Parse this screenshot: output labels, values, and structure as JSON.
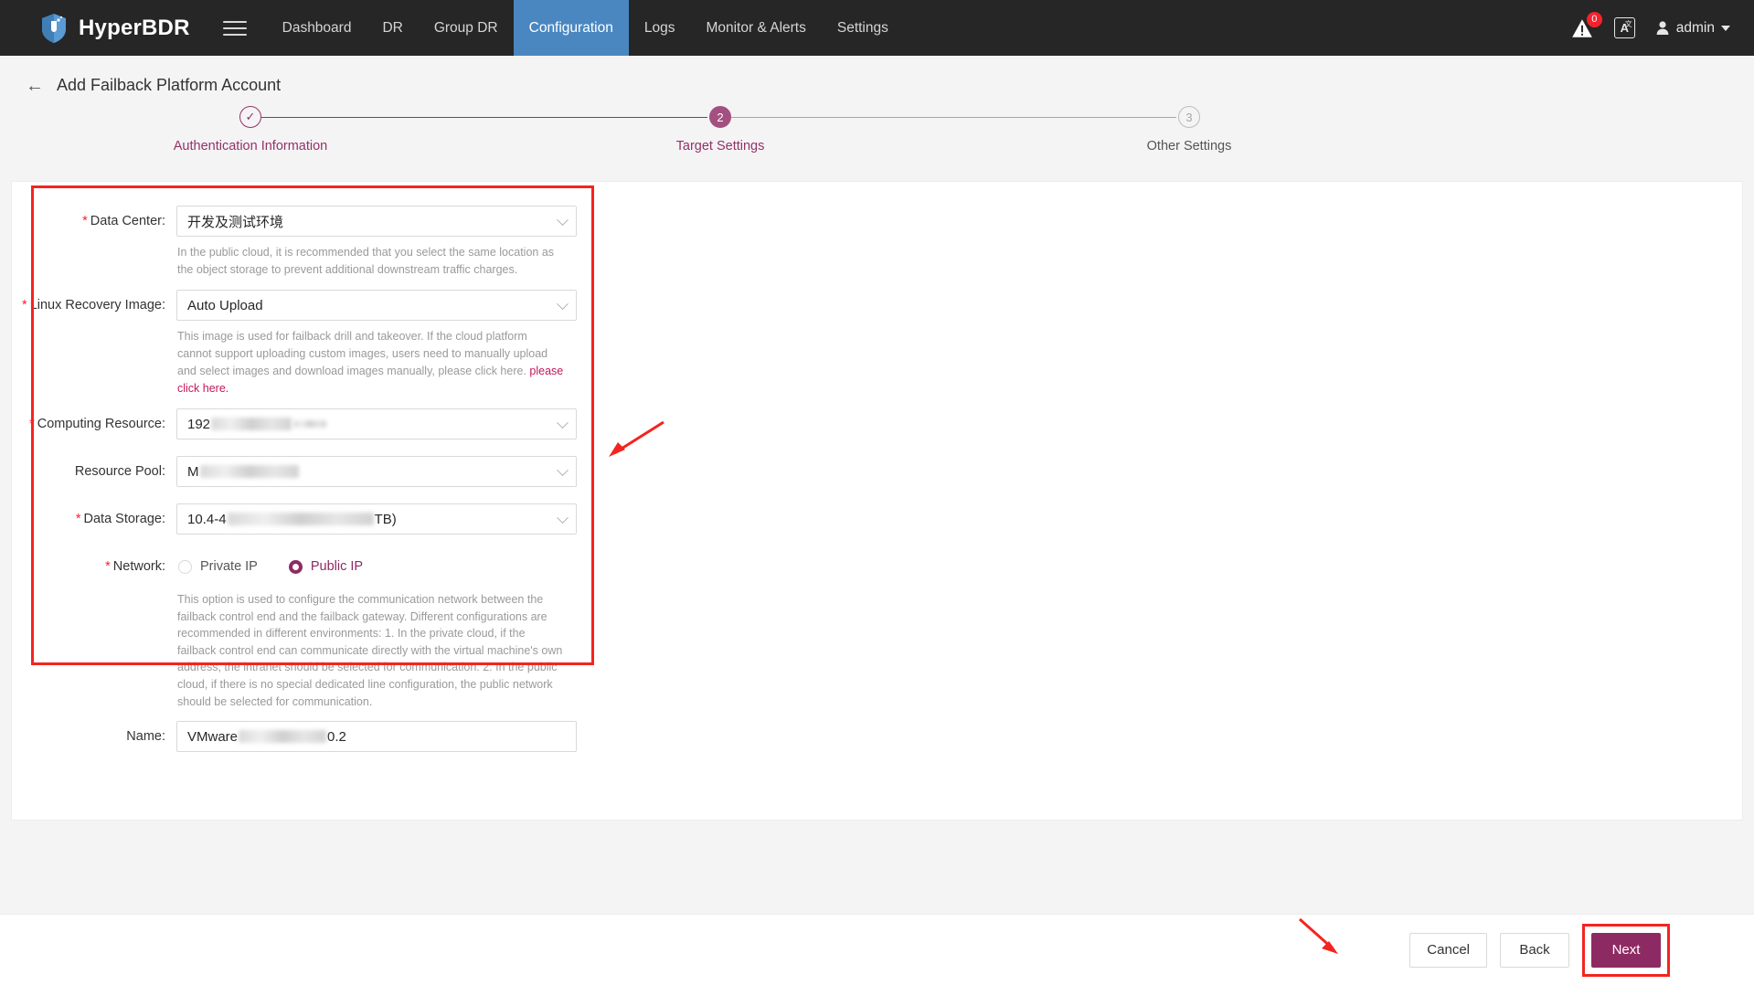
{
  "header": {
    "brand": "HyperBDR",
    "menu_icon": "hamburger-icon",
    "nav": [
      {
        "label": "Dashboard",
        "active": false
      },
      {
        "label": "DR",
        "active": false
      },
      {
        "label": "Group DR",
        "active": false
      },
      {
        "label": "Configuration",
        "active": true
      },
      {
        "label": "Logs",
        "active": false
      },
      {
        "label": "Monitor & Alerts",
        "active": false
      },
      {
        "label": "Settings",
        "active": false
      }
    ],
    "alert_badge": "0",
    "language_icon": "A",
    "language_icon_sup": "文",
    "user": "admin",
    "active_color": "#4a87c0"
  },
  "page": {
    "back_arrow": "←",
    "title": "Add Failback Platform Account"
  },
  "steps": [
    {
      "num": "1",
      "mark": "✓",
      "label": "Authentication Information",
      "state": "done"
    },
    {
      "num": "2",
      "mark": "2",
      "label": "Target Settings",
      "state": "current"
    },
    {
      "num": "3",
      "mark": "3",
      "label": "Other Settings",
      "state": "todo"
    }
  ],
  "accent": "#8e2a63",
  "form": {
    "data_center": {
      "label": "Data Center:",
      "required": true,
      "value": "开发及测试环境",
      "hint": "In the public cloud, it is recommended that you select the same location as the object storage to prevent additional downstream traffic charges."
    },
    "linux_recovery_image": {
      "label": "Linux Recovery Image:",
      "required": true,
      "value": "Auto Upload",
      "hint": "This image is used for failback drill and takeover. If the cloud platform cannot support uploading custom images, users need to manually upload and select images and download images manually, please click here.",
      "hint_link": "please click here."
    },
    "computing_resource": {
      "label": "Computing Resource:",
      "required": true,
      "value_prefix": "192",
      "value_suffix": "",
      "redacted": true
    },
    "resource_pool": {
      "label": "Resource Pool:",
      "required": false,
      "value_prefix": "M",
      "value_suffix": "",
      "redacted": true
    },
    "data_storage": {
      "label": "Data Storage:",
      "required": true,
      "value_prefix": "10.4-4",
      "value_suffix": "TB)",
      "redacted": true
    },
    "network": {
      "label": "Network:",
      "required": true,
      "options": [
        {
          "label": "Private IP",
          "selected": false
        },
        {
          "label": "Public IP",
          "selected": true
        }
      ],
      "hint": "This option is used to configure the communication network between the failback control end and the failback gateway. Different configurations are recommended in different environments: 1. In the private cloud, if the failback control end can communicate directly with the virtual machine's own address, the intranet should be selected for communication. 2. In the public cloud, if there is no special dedicated line configuration, the public network should be selected for communication."
    },
    "name": {
      "label": "Name:",
      "required": false,
      "value_prefix": "VMware",
      "value_suffix": "0.2",
      "redacted": true
    }
  },
  "footer": {
    "cancel": "Cancel",
    "back": "Back",
    "next": "Next"
  }
}
